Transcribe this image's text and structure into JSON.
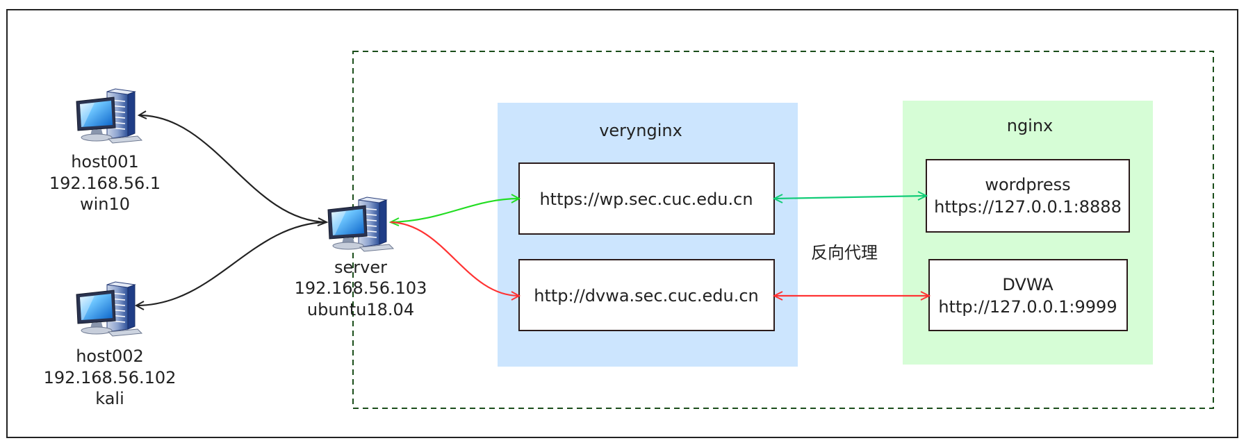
{
  "hosts": {
    "host001": {
      "name": "host001",
      "ip": "192.168.56.1",
      "os": "win10"
    },
    "host002": {
      "name": "host002",
      "ip": "192.168.56.102",
      "os": "kali"
    },
    "server": {
      "name": "server",
      "ip": "192.168.56.103",
      "os": "ubuntu18.04"
    }
  },
  "verynginx": {
    "title": "verynginx",
    "wp_url": "https://wp.sec.cuc.edu.cn",
    "dvwa_url": "http://dvwa.sec.cuc.edu.cn"
  },
  "nginx": {
    "title": "nginx",
    "wordpress": {
      "name": "wordpress",
      "url": "https://127.0.0.1:8888"
    },
    "dvwa": {
      "name": "DVWA",
      "url": "http://127.0.0.1:9999"
    }
  },
  "proxy_label": "反向代理",
  "colors": {
    "verynginx_bg": "#cce5fe",
    "nginx_bg": "#d6fdd6",
    "green_arrow": "#22dd22",
    "teal_arrow": "#11cc77",
    "red_arrow": "#ff3333",
    "dark_line": "#222222",
    "dashed_border": "#1a4d1a"
  },
  "icons": [
    "computer-icon"
  ]
}
